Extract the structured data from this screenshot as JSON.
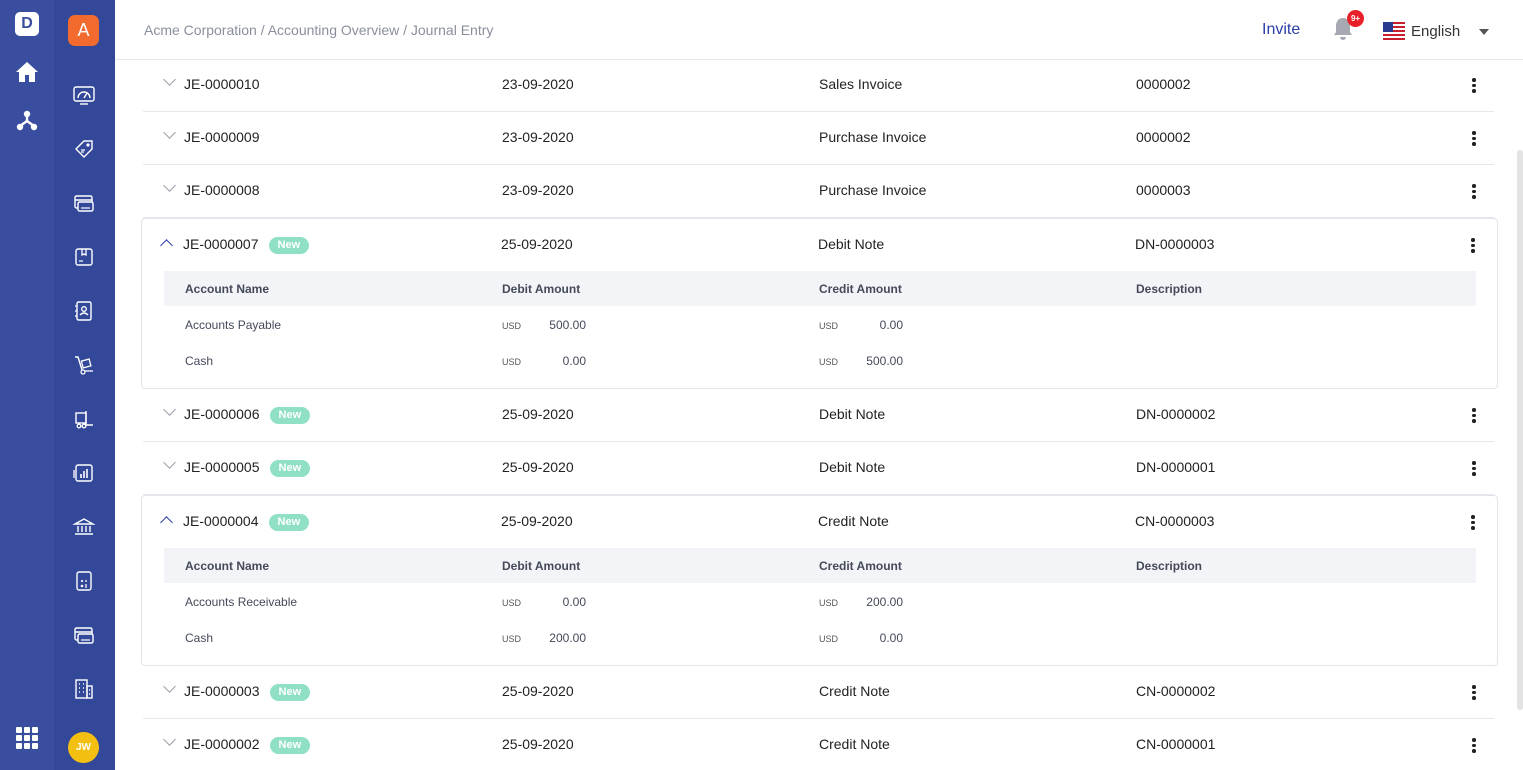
{
  "sidebar": {
    "logo": "D",
    "tenant_initial": "A",
    "user_initials": "JW"
  },
  "header": {
    "breadcrumb": "Acme Corporation / Accounting Overview / Journal Entry",
    "invite_label": "Invite",
    "notification_count": "9+",
    "language": "English"
  },
  "journal": {
    "rows": [
      {
        "id": "JE-0000010",
        "date": "23-09-2020",
        "type": "Sales Invoice",
        "ref": "0000002",
        "is_new": false,
        "expanded": false
      },
      {
        "id": "JE-0000009",
        "date": "23-09-2020",
        "type": "Purchase Invoice",
        "ref": "0000002",
        "is_new": false,
        "expanded": false
      },
      {
        "id": "JE-0000008",
        "date": "23-09-2020",
        "type": "Purchase Invoice",
        "ref": "0000003",
        "is_new": false,
        "expanded": false
      },
      {
        "id": "JE-0000007",
        "date": "25-09-2020",
        "type": "Debit Note",
        "ref": "DN-0000003",
        "is_new": true,
        "expanded": true,
        "lines": [
          {
            "account": "Accounts Payable",
            "debit_cur": "USD",
            "debit": "500.00",
            "credit_cur": "USD",
            "credit": "0.00"
          },
          {
            "account": "Cash",
            "debit_cur": "USD",
            "debit": "0.00",
            "credit_cur": "USD",
            "credit": "500.00"
          }
        ]
      },
      {
        "id": "JE-0000006",
        "date": "25-09-2020",
        "type": "Debit Note",
        "ref": "DN-0000002",
        "is_new": true,
        "expanded": false
      },
      {
        "id": "JE-0000005",
        "date": "25-09-2020",
        "type": "Debit Note",
        "ref": "DN-0000001",
        "is_new": true,
        "expanded": false
      },
      {
        "id": "JE-0000004",
        "date": "25-09-2020",
        "type": "Credit Note",
        "ref": "CN-0000003",
        "is_new": true,
        "expanded": true,
        "lines": [
          {
            "account": "Accounts Receivable",
            "debit_cur": "USD",
            "debit": "0.00",
            "credit_cur": "USD",
            "credit": "200.00"
          },
          {
            "account": "Cash",
            "debit_cur": "USD",
            "debit": "200.00",
            "credit_cur": "USD",
            "credit": "0.00"
          }
        ]
      },
      {
        "id": "JE-0000003",
        "date": "25-09-2020",
        "type": "Credit Note",
        "ref": "CN-0000002",
        "is_new": true,
        "expanded": false
      },
      {
        "id": "JE-0000002",
        "date": "25-09-2020",
        "type": "Credit Note",
        "ref": "CN-0000001",
        "is_new": true,
        "expanded": false
      }
    ],
    "new_label": "New",
    "detail_headers": {
      "account": "Account Name",
      "debit": "Debit Amount",
      "credit": "Credit Amount",
      "description": "Description"
    }
  },
  "colors": {
    "sidebar_primary": "#3a4ea0",
    "sidebar_secondary": "#34489a",
    "accent": "#2b3ea8",
    "new_badge": "#8fe0c5"
  }
}
